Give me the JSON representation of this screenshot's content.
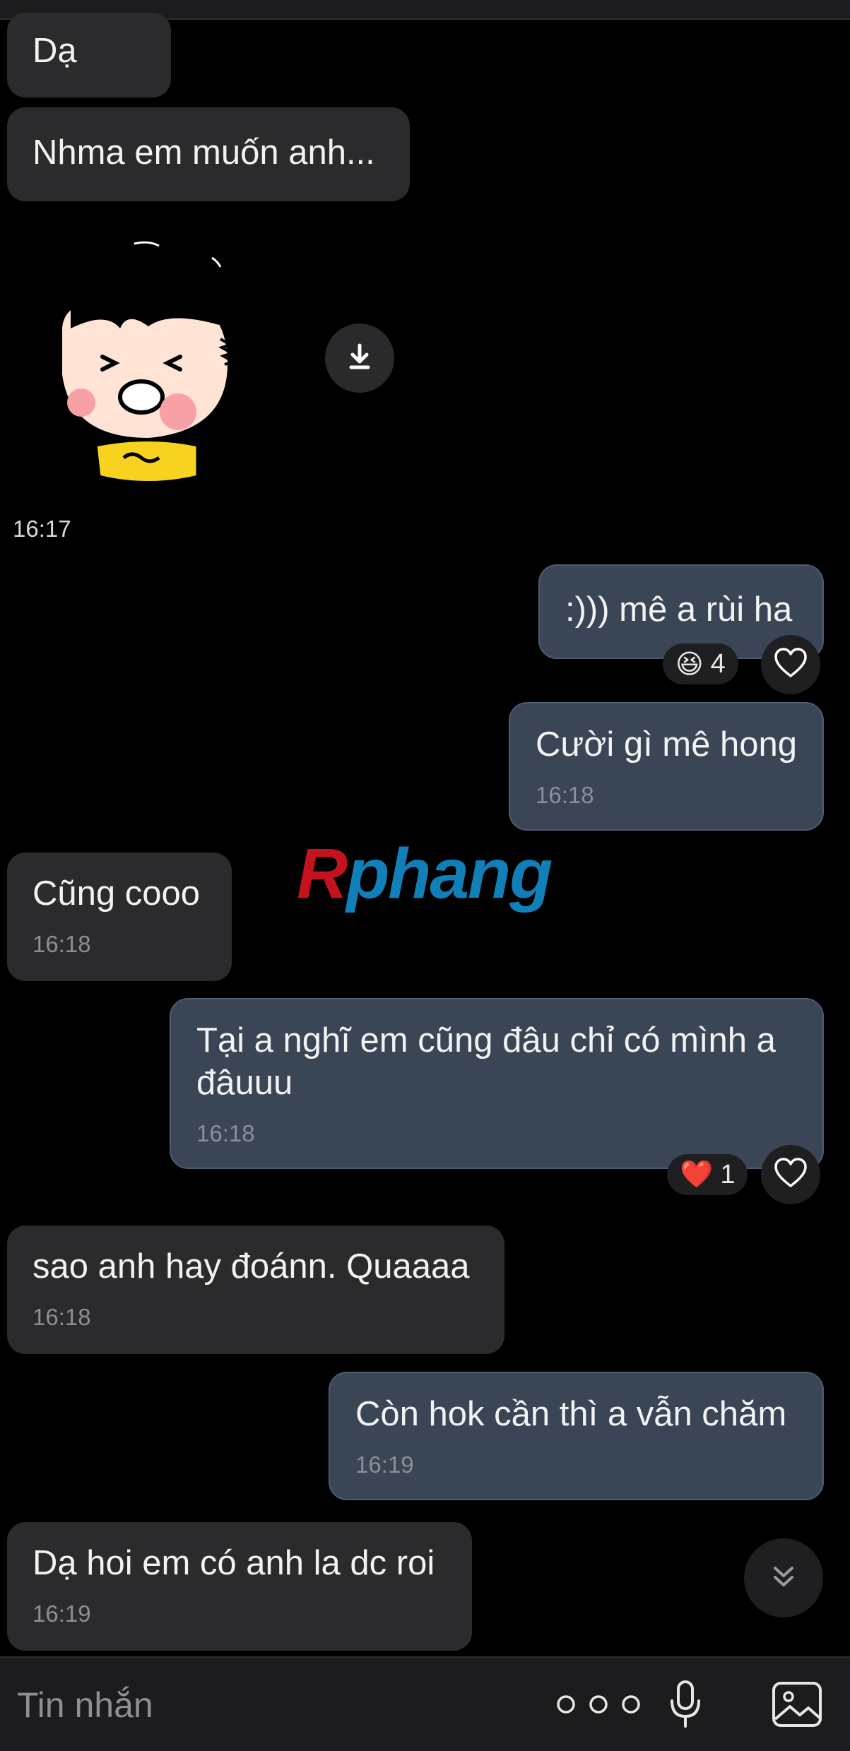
{
  "messages": [
    {
      "id": "m1",
      "side": "in",
      "text": "Dạ"
    },
    {
      "id": "m2",
      "side": "in",
      "text": "Nhma em muốn anh..."
    },
    {
      "id": "m3",
      "side": "in",
      "type": "sticker",
      "time": "16:17"
    },
    {
      "id": "m4",
      "side": "out",
      "text": ":))) mê a rùi ha",
      "reaction": {
        "emoji": "😆",
        "count": "4"
      }
    },
    {
      "id": "m5",
      "side": "out",
      "text": "Cười gì mê hong",
      "time": "16:18"
    },
    {
      "id": "m6",
      "side": "in",
      "text": "Cũng cooo",
      "time": "16:18"
    },
    {
      "id": "m7",
      "side": "out",
      "text": "Tại a nghĩ em cũng đâu chỉ có mình a đâuuu",
      "time": "16:18",
      "reaction": {
        "emoji": "❤️",
        "count": "1"
      }
    },
    {
      "id": "m8",
      "side": "in",
      "text": "sao anh hay đoánn. Quaaaa",
      "time": "16:18"
    },
    {
      "id": "m9",
      "side": "out",
      "text": "Còn hok cần thì a vẫn chăm",
      "time": "16:19"
    },
    {
      "id": "m10",
      "side": "in",
      "text": "Dạ hoi em có anh la dc roi",
      "time": "16:19"
    }
  ],
  "watermark": {
    "first": "R",
    "rest": "phang"
  },
  "composer": {
    "placeholder": "Tin nhắn"
  },
  "icons": {
    "download": "download-icon",
    "heart": "heart-outline-icon",
    "scroll": "double-chevron-down-icon",
    "more": "more-dots-icon",
    "mic": "microphone-icon",
    "gallery": "image-gallery-icon"
  },
  "colors": {
    "background": "#000000",
    "incoming_bubble": "#2b2b2d",
    "outgoing_bubble": "#3a4555",
    "outgoing_border": "#4e5c72",
    "time_text": "#8b8f96",
    "watermark_red": "#c4121f",
    "watermark_blue": "#1180b8"
  }
}
